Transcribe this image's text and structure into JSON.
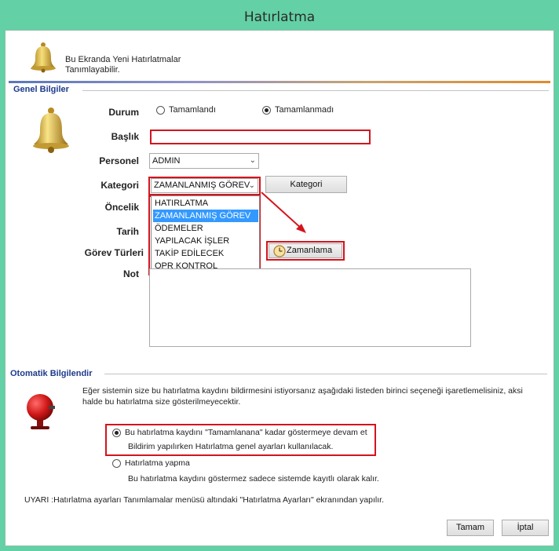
{
  "window": {
    "title": "Hatırlatma"
  },
  "header": {
    "line1": "Bu Ekranda Yeni Hatırlatmalar",
    "line2": "Tanımlayabilir."
  },
  "general": {
    "group_title": "Genel Bilgiler",
    "durum_label": "Durum",
    "radio_done": "Tamamlandı",
    "radio_not_done": "Tamamlanmadı",
    "baslik_label": "Başlık",
    "baslik_value": "",
    "personel_label": "Personel",
    "personel_value": "ADMIN",
    "kategori_label": "Kategori",
    "kategori_value": "ZAMANLANMIŞ GÖREV",
    "kategori_button": "Kategori",
    "oncelik_label": "Öncelik",
    "tarih_label": "Tarih",
    "gorev_label": "Görev Türleri",
    "zamanlama_button": "Zamanlama",
    "not_label": "Not",
    "not_value": ""
  },
  "kategori_options": [
    "HATIRLATMA",
    "ZAMANLANMIŞ GÖREV",
    "ÖDEMELER",
    "YAPILACAK İŞLER",
    "TAKİP EDİLECEK",
    "OPR KONTROL"
  ],
  "auto": {
    "group_title": "Otomatik Bilgilendir",
    "description_line1": "Eğer sistemin size bu hatırlatma kaydını bildirmesini istiyorsanız aşağıdaki listeden birinci seçeneği işaretlemelisiniz, aksi",
    "description_line2": "halde bu hatırlatma size gösterilmeyecektir.",
    "option1_line1": "Bu hatırlatma kaydını \"Tamamlanana\" kadar göstermeye devam et",
    "option1_line2": "Bildirim yapılırken Hatırlatma genel ayarları kullanılacak.",
    "option2_label": "Hatırlatma yapma",
    "option2_desc": "Bu hatırlatma kaydını göstermez sadece sistemde kayıtlı olarak kalır.",
    "warning": "UYARI :Hatırlatma ayarları Tanımlamalar menüsü altındaki \"Hatırlatma Ayarları\" ekranından yapılır."
  },
  "footer": {
    "ok_button": "Tamam",
    "cancel_button": "İptal"
  },
  "colors": {
    "window_frame": "#63d1a5",
    "highlight_red": "#d3141d",
    "selection_blue": "#3399ff",
    "group_title": "#1e3a8c"
  }
}
